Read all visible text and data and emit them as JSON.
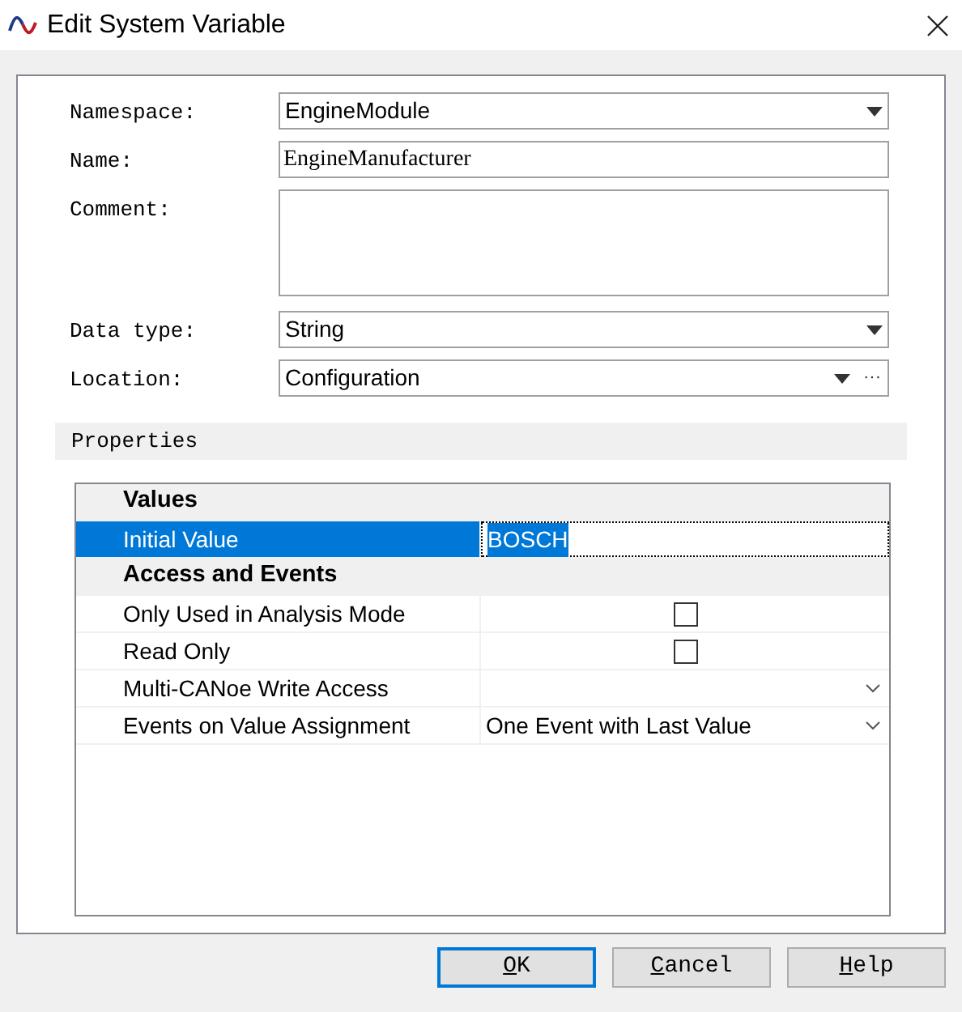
{
  "window": {
    "title": "Edit System Variable"
  },
  "fields": [
    {
      "kind": "dropdown",
      "label": "Namespace:",
      "value": "EngineModule"
    },
    {
      "kind": "text",
      "label": "Name:",
      "value": "EngineManufacturer"
    },
    {
      "kind": "multiline",
      "label": "Comment:"
    },
    {
      "kind": "dropdown",
      "label": "Data type:",
      "value": "String"
    },
    {
      "kind": "dropdown",
      "label": "Location:",
      "value": "Configuration",
      "browse_button": "···"
    }
  ],
  "properties": {
    "title": "Properties",
    "rows": [
      {
        "kind": "category",
        "label": "Values"
      },
      {
        "kind": "text",
        "label": "Initial Value",
        "value": "BOSCH",
        "selected": true
      },
      {
        "kind": "category",
        "label": "Access and Events"
      },
      {
        "kind": "checkbox",
        "label": "Only Used in Analysis Mode",
        "checked": false,
        "selected": false
      },
      {
        "kind": "checkbox",
        "label": "Read Only",
        "checked": false,
        "selected": false
      },
      {
        "kind": "dropdown",
        "label": "Multi-CANoe Write Access",
        "selected": false
      },
      {
        "kind": "dropdown",
        "label": "Events on Value Assignment",
        "value": "One Event with Last Value",
        "selected": false
      }
    ]
  },
  "buttons": [
    {
      "label": "OK",
      "default": true,
      "mnemonic_underlined": true
    },
    {
      "label": "Cancel",
      "default": false,
      "mnemonic_underlined": true
    },
    {
      "label": "Help",
      "default": false,
      "mnemonic_underlined": true
    }
  ]
}
